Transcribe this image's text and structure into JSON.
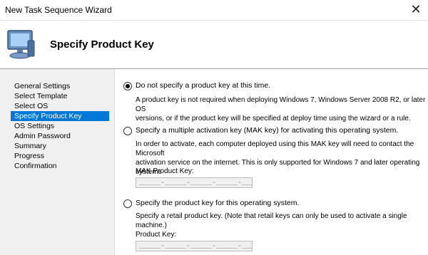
{
  "window": {
    "title": "New Task Sequence Wizard",
    "close_glyph": "✕"
  },
  "header": {
    "page_title": "Specify Product Key"
  },
  "sidebar": {
    "items": [
      {
        "label": "General Settings"
      },
      {
        "label": "Select Template"
      },
      {
        "label": "Select OS"
      },
      {
        "label": "Specify Product Key"
      },
      {
        "label": "OS Settings"
      },
      {
        "label": "Admin Password"
      },
      {
        "label": "Summary"
      },
      {
        "label": "Progress"
      },
      {
        "label": "Confirmation"
      }
    ],
    "selected": "Specify Product Key"
  },
  "options": {
    "no_key": {
      "label": "Do not specify a product key at this time.",
      "desc1": "A product key is not required when deploying Windows 7, Windows Server 2008 R2, or later OS",
      "desc2": "versions, or if the product key will be specified at deploy time using the wizard or a rule.",
      "selected": true
    },
    "mak": {
      "label": "Specify a multiple activation key (MAK key) for activating this operating system.",
      "desc1": "In order to activate, each computer deployed using this MAK key will need to contact the Microsoft",
      "desc2": "activation service on the internet.  This is only supported for Windows 7 and later operating systems",
      "desc3": "when using volume license media.",
      "field_label": "MAK Product Key:",
      "field_value": "_____-_____-_____-_____-_____",
      "selected": false
    },
    "retail": {
      "label": "Specify the product key for this operating system.",
      "desc1": "Specify a retail product key.  (Note that retail keys can only be used to activate a single machine.)",
      "field_label": "Product Key:",
      "field_value": "_____-_____-_____-_____-_____",
      "selected": false
    }
  }
}
